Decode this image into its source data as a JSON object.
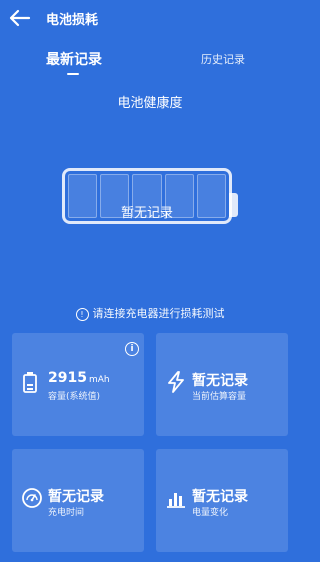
{
  "header": {
    "title": "电池损耗"
  },
  "tabs": {
    "latest": "最新记录",
    "history": "历史记录"
  },
  "health": {
    "title": "电池健康度",
    "status": "暂无记录"
  },
  "hint": {
    "icon": "!",
    "text": "请连接充电器进行损耗测试"
  },
  "cards": {
    "capacity": {
      "value": "2915",
      "unit": "mAh",
      "label": "容量(系统值)",
      "info_icon": "i"
    },
    "estimate": {
      "value": "暂无记录",
      "label": "当前估算容量"
    },
    "charge_time": {
      "value": "暂无记录",
      "label": "充电时间"
    },
    "charge_change": {
      "value": "暂无记录",
      "label": "电量变化"
    }
  },
  "colors": {
    "background": "#2f6fdc",
    "text": "#ffffff"
  }
}
